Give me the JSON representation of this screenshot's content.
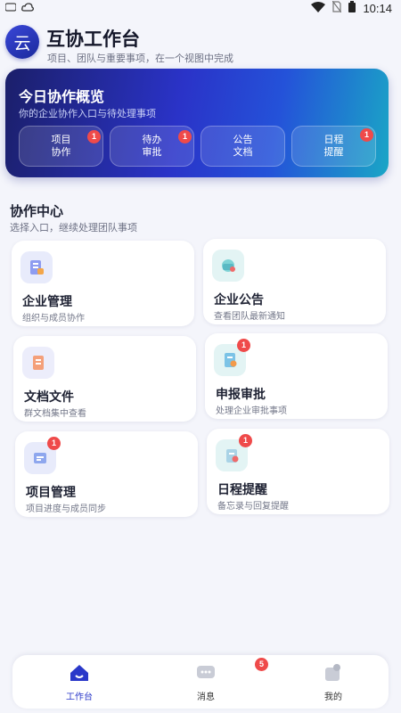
{
  "status_bar": {
    "time": "10:14"
  },
  "header": {
    "logo_char": "云",
    "title": "互协工作台",
    "subtitle": "项目、团队与重要事项，在一个视图中完成"
  },
  "overview": {
    "title": "今日协作概览",
    "subtitle": "你的企业协作入口与待处理事项",
    "chips": [
      {
        "label": "项目协作",
        "badge": "1"
      },
      {
        "label": "待办审批",
        "badge": "1"
      },
      {
        "label": "公告文档",
        "badge": ""
      },
      {
        "label": "日程提醒",
        "badge": "1"
      }
    ]
  },
  "section": {
    "title": "协作中心",
    "subtitle": "选择入口，继续处理团队事项"
  },
  "cards": [
    {
      "title": "企业管理",
      "desc": "组织与成员协作",
      "icon": "building-icon",
      "badge": ""
    },
    {
      "title": "企业公告",
      "desc": "查看团队最新通知",
      "icon": "megaphone-icon",
      "badge": ""
    },
    {
      "title": "文档文件",
      "desc": "群文档集中查看",
      "icon": "document-icon",
      "badge": ""
    },
    {
      "title": "申报审批",
      "desc": "处理企业审批事项",
      "icon": "approval-icon",
      "badge": "1"
    },
    {
      "title": "项目管理",
      "desc": "项目进度与成员同步",
      "icon": "project-icon",
      "badge": "1"
    },
    {
      "title": "日程提醒",
      "desc": "备忘录与回复提醒",
      "icon": "calendar-icon",
      "badge": "1"
    }
  ],
  "tabbar": {
    "tabs": [
      {
        "label": "工作台",
        "icon": "home-icon",
        "active": true,
        "badge": ""
      },
      {
        "label": "消息",
        "icon": "message-icon",
        "active": false,
        "badge": "5"
      },
      {
        "label": "我的",
        "icon": "profile-icon",
        "active": false,
        "badge": ""
      }
    ]
  },
  "colors": {
    "accent": "#2a38c9",
    "badge": "#ef4a4a",
    "background": "#f4f5fb"
  }
}
